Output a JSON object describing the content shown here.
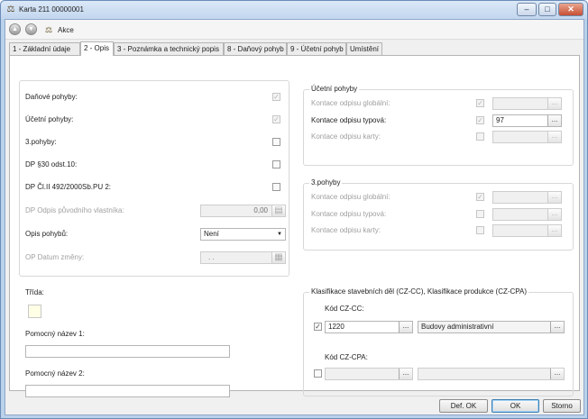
{
  "window": {
    "title": "Karta 211 00000001",
    "controls": {
      "minimize": "‒",
      "maximize": "□",
      "close": "✕"
    }
  },
  "toolbar": {
    "akce_label": "Akce"
  },
  "tabs": [
    "1 - Základní údaje",
    "2 - Opis",
    "3 - Poznámka a technický popis",
    "8 - Daňový pohyb",
    "9 - Účetní pohyb",
    "Umístění"
  ],
  "active_tab": "2 - Opis",
  "left_group": {
    "danove_pohyby": "Daňové pohyby:",
    "ucetni_pohyby": "Účetní pohyby:",
    "pohyby3": "3.pohyby:",
    "dp30": "DP §30 odst.10:",
    "dp_cl": "DP Čl.II 492/2000Sb.PU 2:",
    "dp_odpis_label": "DP Odpis původního vlastníka:",
    "dp_odpis_value": "0,00",
    "opis_label": "Opis pohybů:",
    "opis_value": "Není",
    "op_datum_label": "OP Datum změny:",
    "op_datum_value": ". ."
  },
  "ucetni_group": {
    "title": "Účetní pohyby",
    "globalni": "Kontace odpisu globální:",
    "typova": "Kontace odpisu typová:",
    "typova_value": "97",
    "karty": "Kontace odpisu karty:"
  },
  "pohyby3_group": {
    "title": "3.pohyby",
    "globalni": "Kontace odpisu globální:",
    "typova": "Kontace odpisu typová:",
    "karty": "Kontace odpisu karty:"
  },
  "bottom_left": {
    "trida": "Třída:",
    "pomocny1": "Pomocný název 1:",
    "pomocny2": "Pomocný název 2:"
  },
  "klasifikace_group": {
    "title": "Klasifikace stavebních děl (CZ-CC), Klasifikace produkce (CZ-CPA)",
    "kod_cc_label": "Kód CZ-CC:",
    "kod_cc_value": "1220",
    "kod_cc_desc": "Budovy administrativní",
    "kod_cpa_label": "Kód CZ-CPA:"
  },
  "buttons": {
    "def_ok": "Def. OK",
    "ok": "OK",
    "storno": "Storno"
  },
  "glyphs": {
    "dots": "...",
    "check": "✓",
    "caret": "▼",
    "calendar": "▦",
    "calc": "▤"
  },
  "icons": [
    "app-icon",
    "nav-back-icon",
    "nav-forward-icon",
    "action-icon",
    "calculator-icon",
    "calendar-icon",
    "dropdown-arrow-icon"
  ]
}
